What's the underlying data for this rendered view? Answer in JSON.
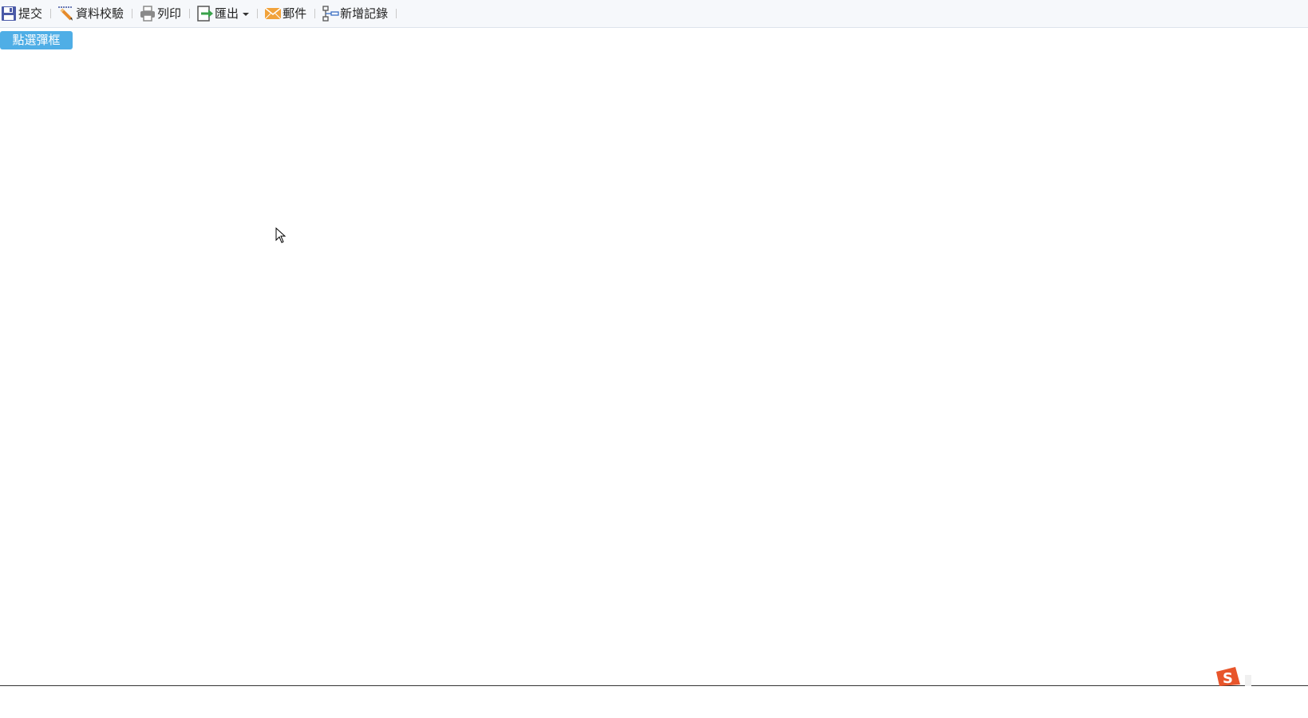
{
  "toolbar": {
    "items": [
      {
        "label": "提交",
        "icon": "save-icon"
      },
      {
        "label": "資料校驗",
        "icon": "validate-pencil-icon"
      },
      {
        "label": "列印",
        "icon": "printer-icon"
      },
      {
        "label": "匯出",
        "icon": "export-icon",
        "has_dropdown": true
      },
      {
        "label": "郵件",
        "icon": "envelope-icon"
      },
      {
        "label": "新增記錄",
        "icon": "add-record-icon"
      }
    ]
  },
  "main": {
    "popup_button_label": "點選彈框"
  },
  "colors": {
    "toolbar_bg": "#f6f8fb",
    "popup_button_bg": "#4faee6",
    "save_icon": "#4b5aa8",
    "export_icon": "#3aa24a",
    "envelope_icon": "#f1a23a",
    "ime_logo": "#e8552b"
  },
  "system_tray": {
    "ime_icon": "sogou-ime-icon"
  }
}
